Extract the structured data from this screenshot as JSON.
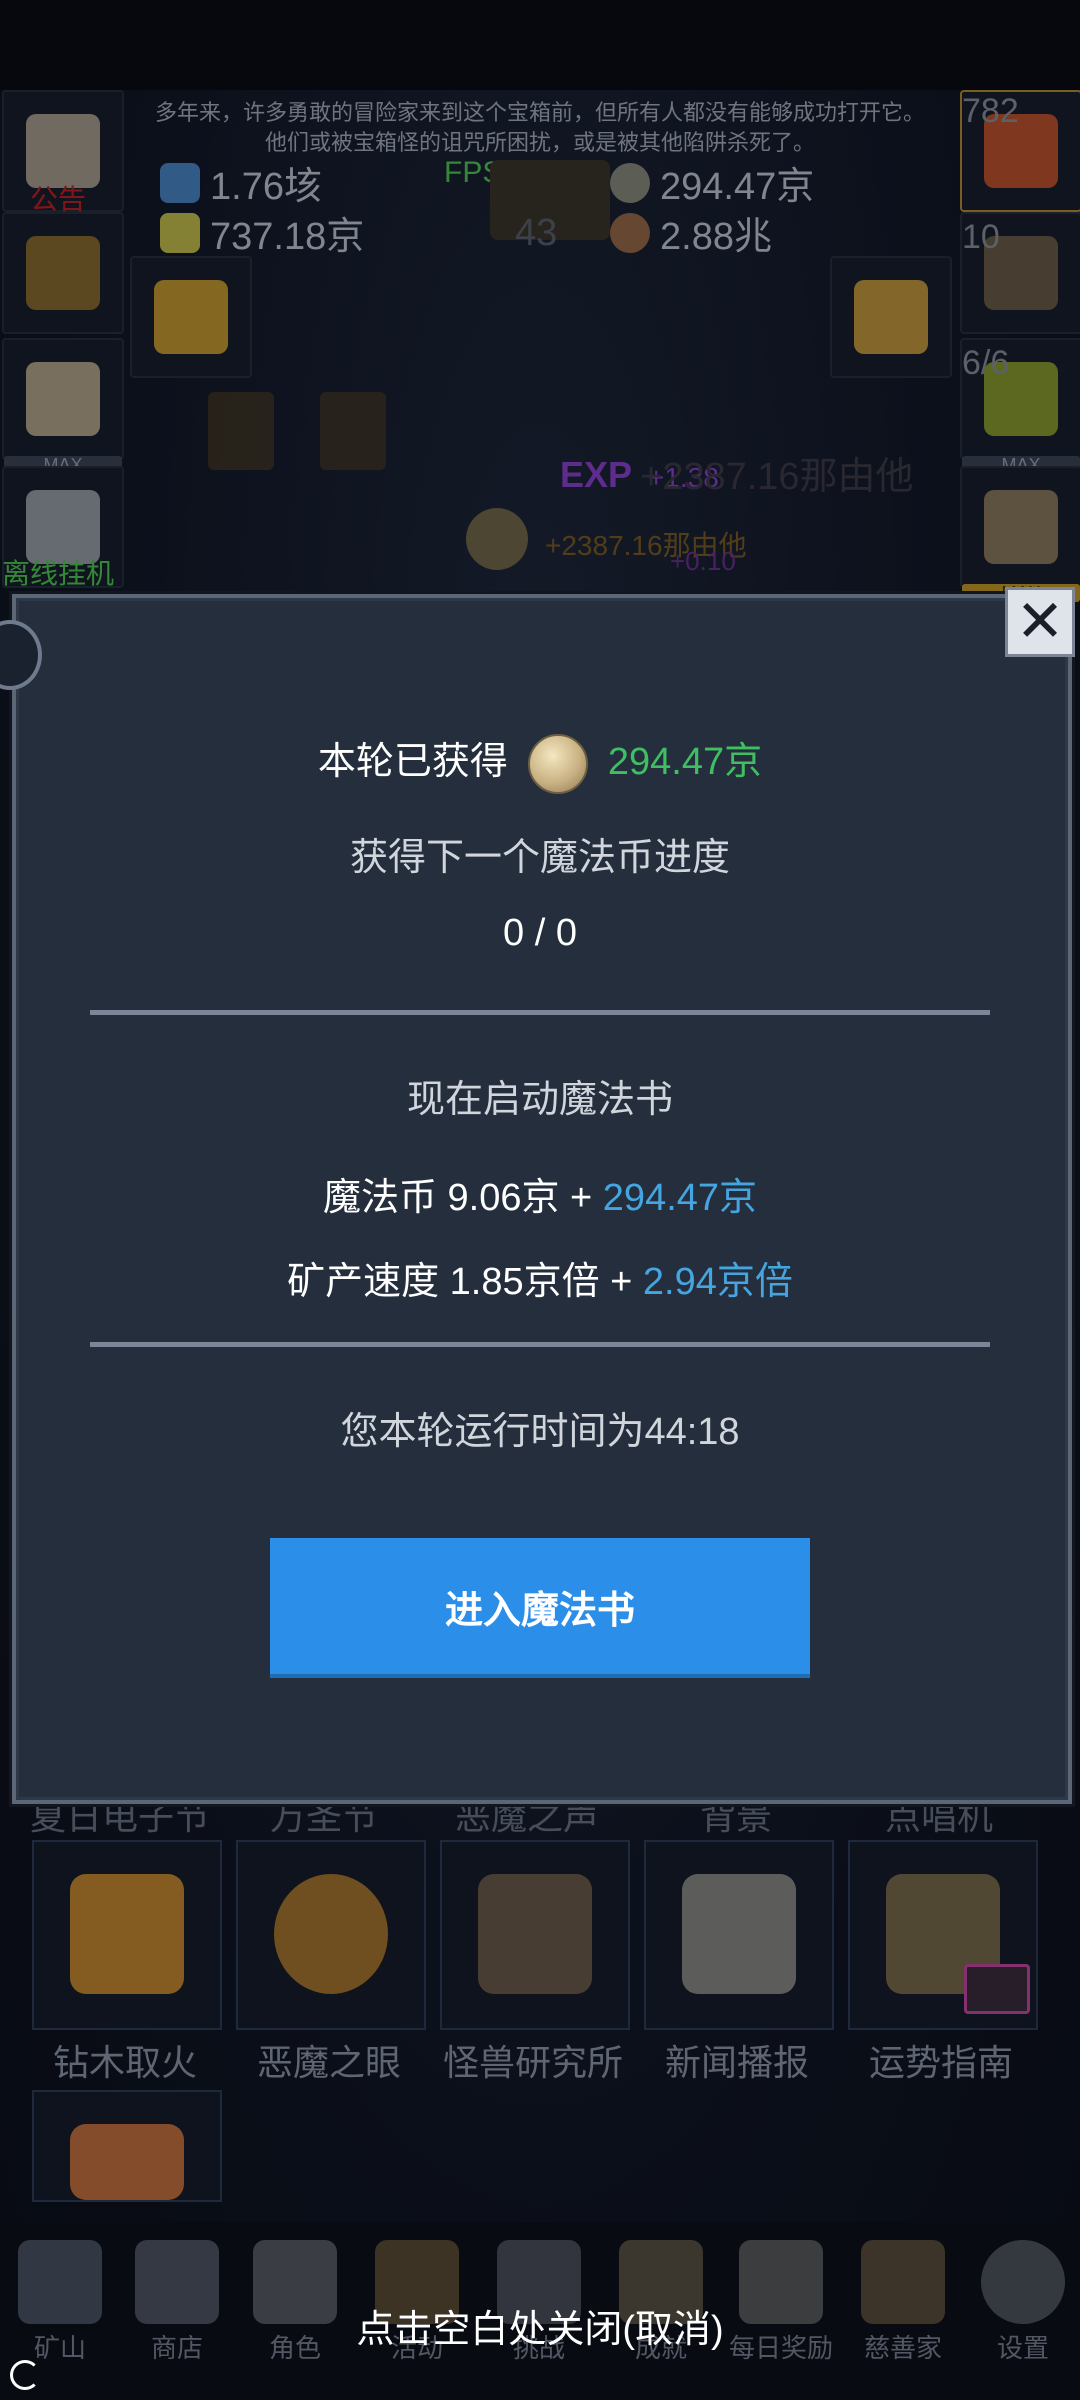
{
  "notice": {
    "line1": "多年来，许多勇敢的冒险家来到这个宝箱前，但所有人都没有能够成功打开它。",
    "line2": "他们或被宝箱怪的诅咒所困扰，或是被其他陷阱杀死了。"
  },
  "resources": {
    "r1": "1.76垓",
    "r2": "737.18京",
    "r3": "294.47京",
    "r4": "2.88兆",
    "book_count": "43",
    "fps": "FPS60"
  },
  "left_labels": {
    "announce": "公告",
    "idle": "离线挂机",
    "max1": "MAX"
  },
  "right_labels": {
    "count1": "782",
    "count2": "10",
    "count3": "6/6",
    "max1": "MAX",
    "max2": "MAX"
  },
  "background_float": {
    "exp1": "+1.38",
    "gold1": "+2387.16那由他",
    "gold2": "+2387.16那由他",
    "exp2": "+0.10"
  },
  "dialog": {
    "earned_label": "本轮已获得",
    "earned_value": "294.47京",
    "progress_label": "获得下一个魔法币进度",
    "progress_value": "0 / 0",
    "start_label": "现在启动魔法书",
    "coin_prefix": "魔法币 9.06京 + ",
    "coin_add": "294.47京",
    "speed_prefix": "矿产速度 1.85京倍 + ",
    "speed_add": "2.94京倍",
    "runtime": "您本轮运行时间为44:18",
    "enter_button": "进入魔法书",
    "close_icon": "close-icon"
  },
  "grid": {
    "partial_titles": [
      "夏日电子节",
      "万圣节",
      "恶魔之声",
      "背景",
      "点唱机"
    ],
    "tiles": [
      {
        "label": "钻木取火"
      },
      {
        "label": "恶魔之眼"
      },
      {
        "label": "怪兽研究所"
      },
      {
        "label": "新闻播报"
      },
      {
        "label": "运势指南"
      }
    ]
  },
  "nav": {
    "items": [
      "矿山",
      "商店",
      "角色",
      "活动",
      "挑战",
      "成就",
      "每日奖励",
      "慈善家",
      "设置"
    ]
  },
  "close_hint": "点击空白处关闭(取消)"
}
